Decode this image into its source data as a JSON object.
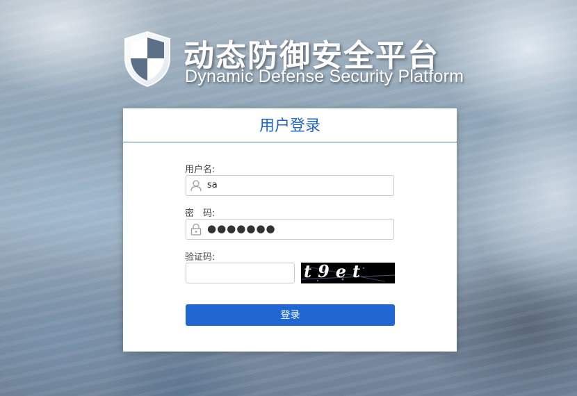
{
  "header": {
    "title_cn": "动态防御安全平台",
    "title_en": "Dynamic Defense Security Platform"
  },
  "login": {
    "panel_title": "用户登录",
    "username_label": "用户名:",
    "username_value": "sa",
    "password_label": "密　码:",
    "password_masked": "●●●●●●●",
    "captcha_label": "验证码:",
    "captcha_value": "",
    "captcha_text": "t9et",
    "submit_label": "登录"
  },
  "colors": {
    "accent": "#1f67c9",
    "button": "#2167d1"
  }
}
